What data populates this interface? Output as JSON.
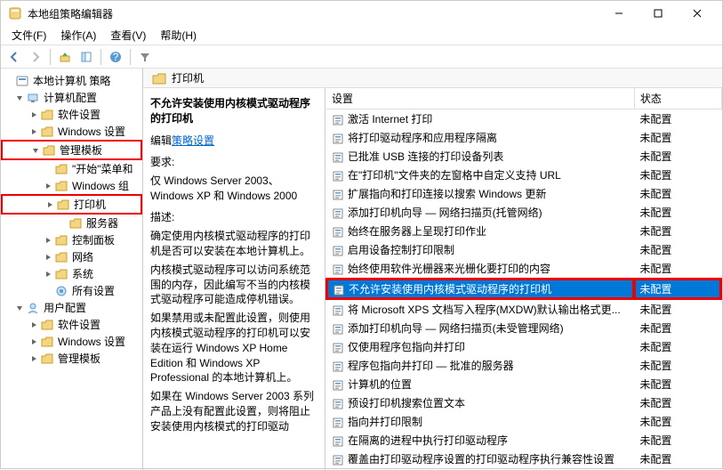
{
  "window": {
    "title": "本地组策略编辑器"
  },
  "menu": {
    "file": "文件(F)",
    "action": "操作(A)",
    "view": "查看(V)",
    "help": "帮助(H)"
  },
  "tree": {
    "root": "本地计算机 策略",
    "computer_config": "计算机配置",
    "software_settings_1": "软件设置",
    "windows_settings_1": "Windows 设置",
    "admin_templates_1": "管理模板",
    "start_menu": "\"开始\"菜单和",
    "windows_comp": "Windows 组",
    "printers": "打印机",
    "servers": "服务器",
    "control_panel": "控制面板",
    "network": "网络",
    "system": "系统",
    "all_settings": "所有设置",
    "user_config": "用户配置",
    "software_settings_2": "软件设置",
    "windows_settings_2": "Windows 设置",
    "admin_templates_2": "管理模板"
  },
  "folder": {
    "title": "打印机"
  },
  "desc": {
    "heading": "不允许安装使用内核模式驱动程序的打印机",
    "edit_label": "编辑",
    "edit_link": "策略设置",
    "req_label": "要求:",
    "req_body": "仅 Windows Server 2003、Windows XP 和 Windows 2000",
    "desc_label": "描述:",
    "desc_body1": "确定使用内核模式驱动程序的打印机是否可以安装在本地计算机上。",
    "desc_body2": "内核模式驱动程序可以访问系统范围的内存，因此编写不当的内核模式驱动程序可能造成停机错误。",
    "desc_body3": "如果禁用或未配置此设置，则使用内核模式驱动程序的打印机可以安装在运行 Windows XP Home Edition 和 Windows XP Professional 的本地计算机上。",
    "desc_body4": "如果在 Windows Server 2003 系列产品上没有配置此设置，则将阻止安装使用内核模式的打印驱动"
  },
  "list": {
    "col_setting": "设置",
    "col_state": "状态",
    "state_not": "未配置",
    "items": [
      "激活 Internet 打印",
      "将打印驱动程序和应用程序隔离",
      "已批准 USB 连接的打印设备列表",
      "在\"打印机\"文件夹的左窗格中自定义支持 URL",
      "扩展指向和打印连接以搜索 Windows 更新",
      "添加打印机向导 — 网络扫描页(托管网络)",
      "始终在服务器上呈现打印作业",
      "启用设备控制打印限制",
      "始终使用软件光栅器来光栅化要打印的内容",
      "不允许安装使用内核模式驱动程序的打印机",
      "将 Microsoft XPS 文档写入程序(MXDW)默认输出格式更...",
      "添加打印机向导 — 网络扫描页(未受管理网络)",
      "仅使用程序包指向并打印",
      "程序包指向并打印 — 批准的服务器",
      "计算机的位置",
      "预设打印机搜索位置文本",
      "指向并打印限制",
      "在隔离的进程中执行打印驱动程序",
      "覆盖由打印驱动程序设置的打印驱动程序执行兼容性设置"
    ],
    "selected_index": 9,
    "highlight_index": 9
  }
}
